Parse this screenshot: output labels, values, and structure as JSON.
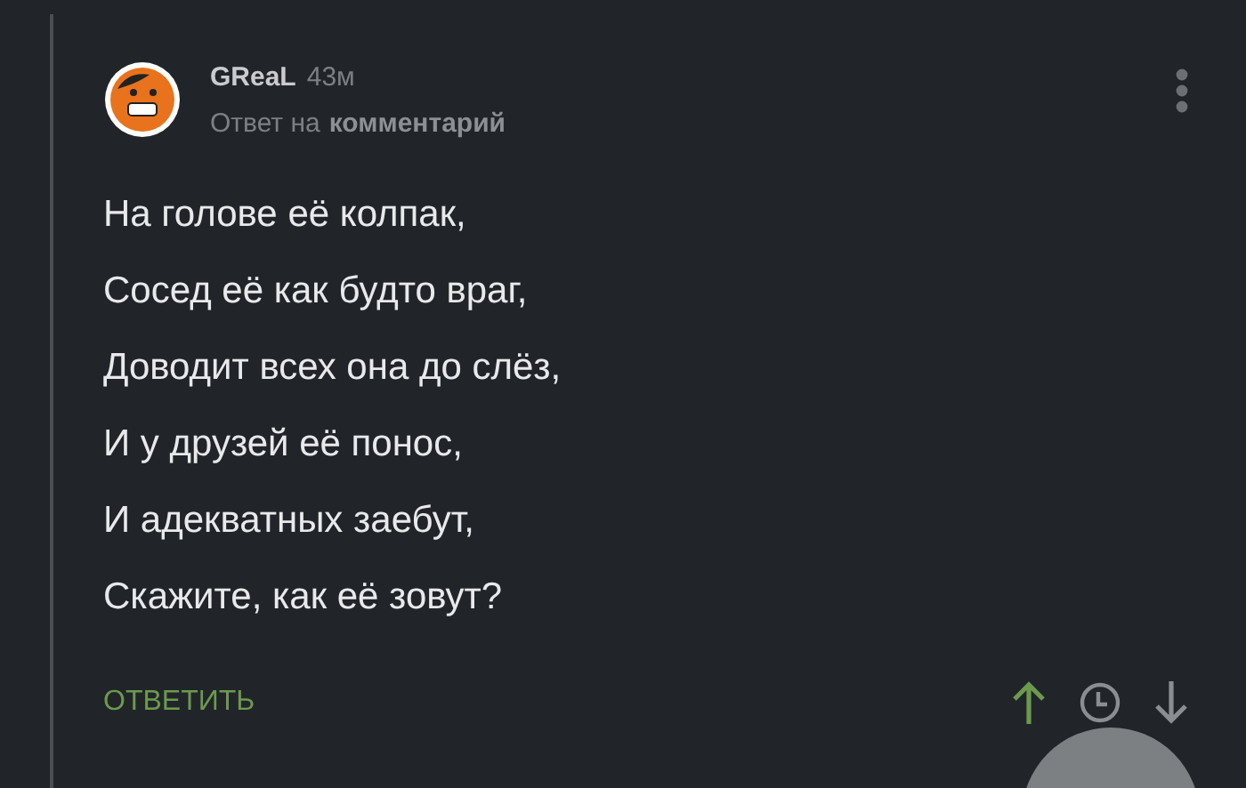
{
  "comment": {
    "author": "GReaL",
    "time": "43м",
    "reply_to": {
      "prefix": "Ответ на",
      "target": "комментарий"
    },
    "lines": [
      "На голове её колпак,",
      "Сосед её как будто враг,",
      "Доводит всех она до слёз,",
      "И у друзей её понос,",
      "И адекватных заебут,",
      "Скажите, как её зовут?"
    ],
    "reply_button": "ОТВЕТИТЬ",
    "upvoted": true,
    "downvoted": false
  }
}
